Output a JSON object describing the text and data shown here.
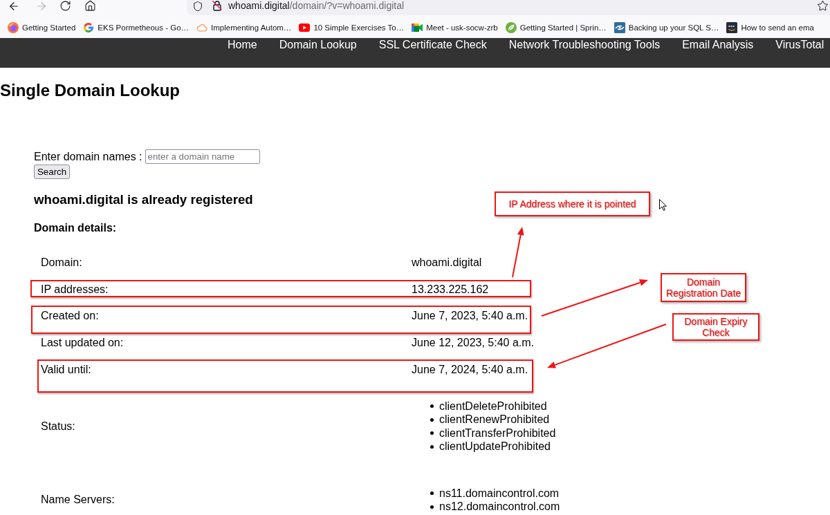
{
  "browser": {
    "url_host": "whoami.digital",
    "url_path": "/domain/?v=whoami.digital",
    "forward_disabled": true
  },
  "bookmarks": [
    {
      "kind": "globe",
      "label": "Getting Started"
    },
    {
      "kind": "g",
      "label": "EKS Pormetheous - Go…"
    },
    {
      "kind": "cloud",
      "label": "Implementing Autom…"
    },
    {
      "kind": "play",
      "label": "10 Simple Exercises To…"
    },
    {
      "kind": "camera",
      "label": "Meet - usk-socw-zrb"
    },
    {
      "kind": "leaf",
      "label": "Getting Started | Sprin…"
    },
    {
      "kind": "swirl",
      "label": "Backing up your SQL S…"
    },
    {
      "kind": "smile",
      "label": "How to send an ema"
    }
  ],
  "nav": [
    "Home",
    "Domain Lookup",
    "SSL Certificate Check",
    "Network Troubleshooting Tools",
    "Email Analysis",
    "VirusTotal"
  ],
  "page": {
    "title": "Single Domain Lookup",
    "form": {
      "label": "Enter domain names :",
      "placeholder": "enter a domain name",
      "button": "Search"
    },
    "message": "whoami.digital is already registered",
    "details_title": "Domain details:"
  },
  "details": {
    "rows": [
      {
        "kind": "text",
        "label": "Domain:",
        "value": "whoami.digital",
        "highlighted": false
      },
      {
        "kind": "text",
        "label": "IP addresses:",
        "value": "13.233.225.162",
        "highlighted": true
      },
      {
        "kind": "text",
        "label": "Created on:",
        "value": "June 7, 2023, 5:40 a.m.",
        "highlighted": true
      },
      {
        "kind": "text",
        "label": "Last updated on:",
        "value": "June 12, 2023, 5:40 a.m.",
        "highlighted": false
      },
      {
        "kind": "text",
        "label": "Valid until:",
        "value": "June 7, 2024, 5:40 a.m.",
        "highlighted": true
      },
      {
        "kind": "list",
        "label": "Status:",
        "values": [
          "clientDeleteProhibited",
          "clientRenewProhibited",
          "clientTransferProhibited",
          "clientUpdateProhibited"
        ],
        "highlighted": false
      },
      {
        "kind": "list",
        "label": "Name Servers:",
        "values": [
          "ns11.domaincontrol.com",
          "ns12.domaincontrol.com"
        ],
        "highlighted": false
      }
    ]
  },
  "annotations": [
    {
      "text": "IP Address where it is pointed"
    },
    {
      "text": "Domain Registration Date"
    },
    {
      "text": "Domain Expiry Check"
    }
  ]
}
